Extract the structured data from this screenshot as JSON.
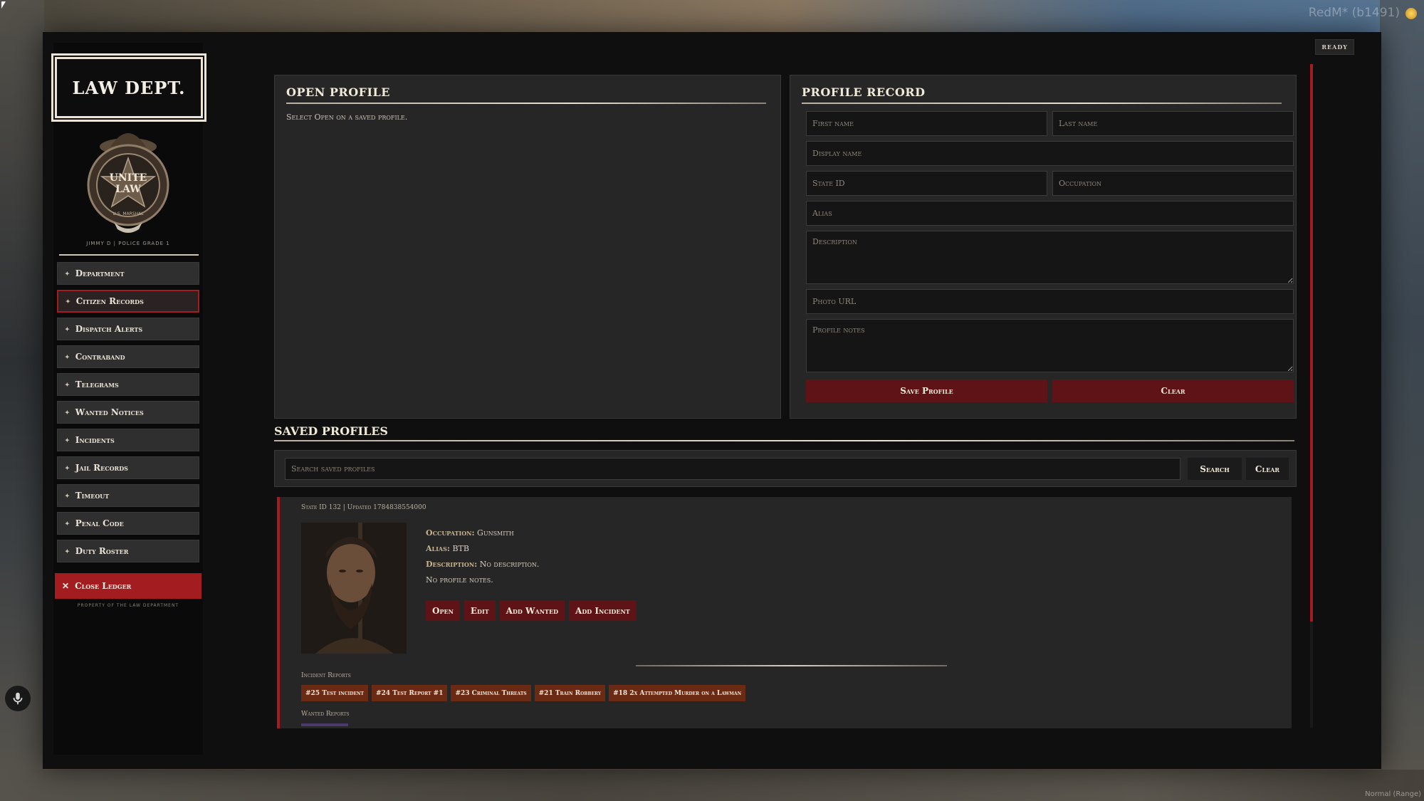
{
  "client": {
    "build_label": "RedM* (b1491)",
    "status_label": "Normal (Range)"
  },
  "header": {
    "ready_label": "READY"
  },
  "sidebar": {
    "title": "LAW DEPT.",
    "badge_text": [
      "UNITE",
      "LAW",
      "U.S. MARSHAL"
    ],
    "officer_rank": "JIMMY D | POLICE GRADE 1",
    "items": [
      {
        "label": "Department"
      },
      {
        "label": "Citizen Records",
        "active": true
      },
      {
        "label": "Dispatch Alerts"
      },
      {
        "label": "Contraband"
      },
      {
        "label": "Telegrams"
      },
      {
        "label": "Wanted Notices"
      },
      {
        "label": "Incidents"
      },
      {
        "label": "Jail Records"
      },
      {
        "label": "Timeout"
      },
      {
        "label": "Penal Code"
      },
      {
        "label": "Duty Roster"
      }
    ],
    "close_label": "Close Ledger",
    "property_note": "PROPERTY OF THE LAW DEPARTMENT"
  },
  "open_profile": {
    "title": "OPEN PROFILE",
    "hint": "Select Open on a saved profile."
  },
  "profile_record": {
    "title": "PROFILE RECORD",
    "placeholders": {
      "first_name": "First name",
      "last_name": "Last name",
      "display_name": "Display name",
      "state_id": "State ID",
      "occupation": "Occupation",
      "alias": "Alias",
      "description": "Description",
      "photo_url": "Photo URL",
      "notes": "Profile notes"
    },
    "save_label": "Save Profile",
    "clear_label": "Clear"
  },
  "saved_profiles": {
    "title": "SAVED PROFILES",
    "search_placeholder": "Search saved profiles",
    "search_label": "Search",
    "clear_label": "Clear",
    "profile": {
      "meta": "State ID 132 | Updated 1784838554000",
      "occupation_label": "Occupation:",
      "occupation": "Gunsmith",
      "alias_label": "Alias:",
      "alias": "BTB",
      "description_label": "Description:",
      "description": "No description.",
      "notes": "No profile notes.",
      "actions": [
        "Open",
        "Edit",
        "Add Wanted",
        "Add Incident"
      ],
      "incident_reports_label": "Incident Reports",
      "incidents": [
        "#25 Test incident",
        "#24 Test Report #1",
        "#23 Criminal Threats",
        "#21 Train Robbery",
        "#18 2x Attempted Murder on a Lawman"
      ],
      "wanted_reports_label": "Wanted Reports"
    }
  },
  "colors": {
    "accent_red": "#a31d20",
    "button_red": "#5e1416",
    "incident_tag": "#6b2a14"
  }
}
